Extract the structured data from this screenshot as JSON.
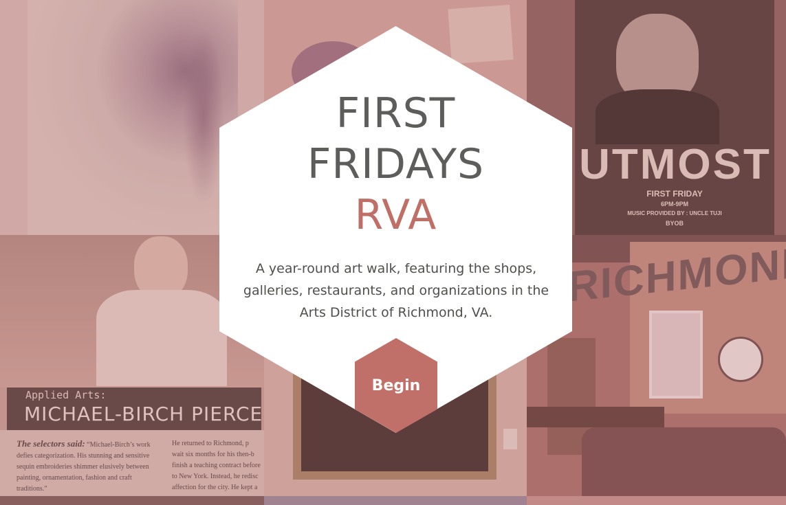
{
  "hero": {
    "title_line1": "FIRST",
    "title_line2": "FRIDAYS",
    "title_line3": "RVA",
    "description": "A year-round art walk, featuring the shops, galleries, restaurants, and organizations in the Arts District of Richmond, VA.",
    "begin_label": "Begin"
  },
  "tiles": {
    "poster": {
      "title": "UTMOST",
      "line1": "FIRST FRIDAY",
      "line2": "6PM-9PM",
      "line3": "MUSIC PROVIDED BY : UNCLE TUJI",
      "line4": "BYOB"
    },
    "magazine": {
      "category": "Applied Arts:",
      "name": "MICHAEL-BIRCH PIERCE",
      "selectors_lead": "The selectors said:",
      "col1_text": "“Michael-Birch’s work defies categorization. His stunning and sensitive sequin embroideries shimmer elusively between painting, ornamentation, fashion and craft traditions.”",
      "col2_text": "He returned to Richmond, p wait six months for his then-b finish a teaching contract before to New York. Instead, he redisc affection for the city. He kept a"
    },
    "shop": {
      "sign": "RICHMOND"
    }
  },
  "colors": {
    "accent": "#c06f66",
    "title_gray": "#5d5e5b",
    "hex_bg": "#ffffff"
  }
}
